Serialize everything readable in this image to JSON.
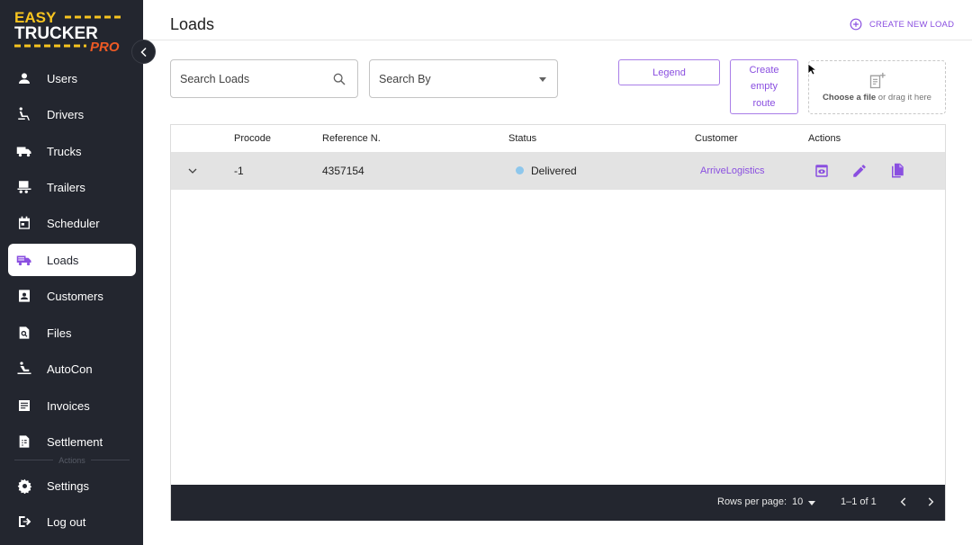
{
  "brand": {
    "line1": "EASY",
    "line2": "TRUCKER",
    "line3": "PRO",
    "accent_yellow": "#f7c41f",
    "accent_orange": "#ee5a24"
  },
  "sidebar": {
    "items": [
      {
        "label": "Users",
        "icon": "person-icon"
      },
      {
        "label": "Drivers",
        "icon": "seat-icon"
      },
      {
        "label": "Trucks",
        "icon": "truck-icon"
      },
      {
        "label": "Trailers",
        "icon": "trailer-icon"
      },
      {
        "label": "Scheduler",
        "icon": "calendar-icon"
      },
      {
        "label": "Loads",
        "icon": "load-truck-icon",
        "active": true
      },
      {
        "label": "Customers",
        "icon": "contact-card-icon"
      },
      {
        "label": "Files",
        "icon": "file-search-icon"
      },
      {
        "label": "AutoCon",
        "icon": "autocon-icon"
      },
      {
        "label": "Invoices",
        "icon": "invoice-icon"
      },
      {
        "label": "Settlement",
        "icon": "settlement-icon"
      }
    ],
    "actions_label": "Actions",
    "settings_label": "Settings",
    "logout_label": "Log out"
  },
  "header": {
    "title": "Loads",
    "create_label": "CREATE NEW LOAD"
  },
  "toolbar": {
    "search_placeholder": "Search Loads",
    "search_by_label": "Search By",
    "legend_label": "Legend",
    "empty_route_label": "Create empty route",
    "dropzone_strong": "Choose a file",
    "dropzone_rest": " or drag it here"
  },
  "table": {
    "columns": [
      "Procode",
      "Reference N.",
      "Status",
      "Customer",
      "Actions"
    ],
    "rows": [
      {
        "procode": "-1",
        "reference": "4357154",
        "status": "Delivered",
        "status_color": "#8ec7ec",
        "customer": "ArriveLogistics"
      }
    ],
    "footer": {
      "rows_per_page_label": "Rows per page:",
      "rows_per_page_value": "10",
      "range": "1–1 of 1"
    }
  },
  "colors": {
    "sidebar_bg": "#23262f",
    "accent_purple": "#8a4fe0"
  }
}
